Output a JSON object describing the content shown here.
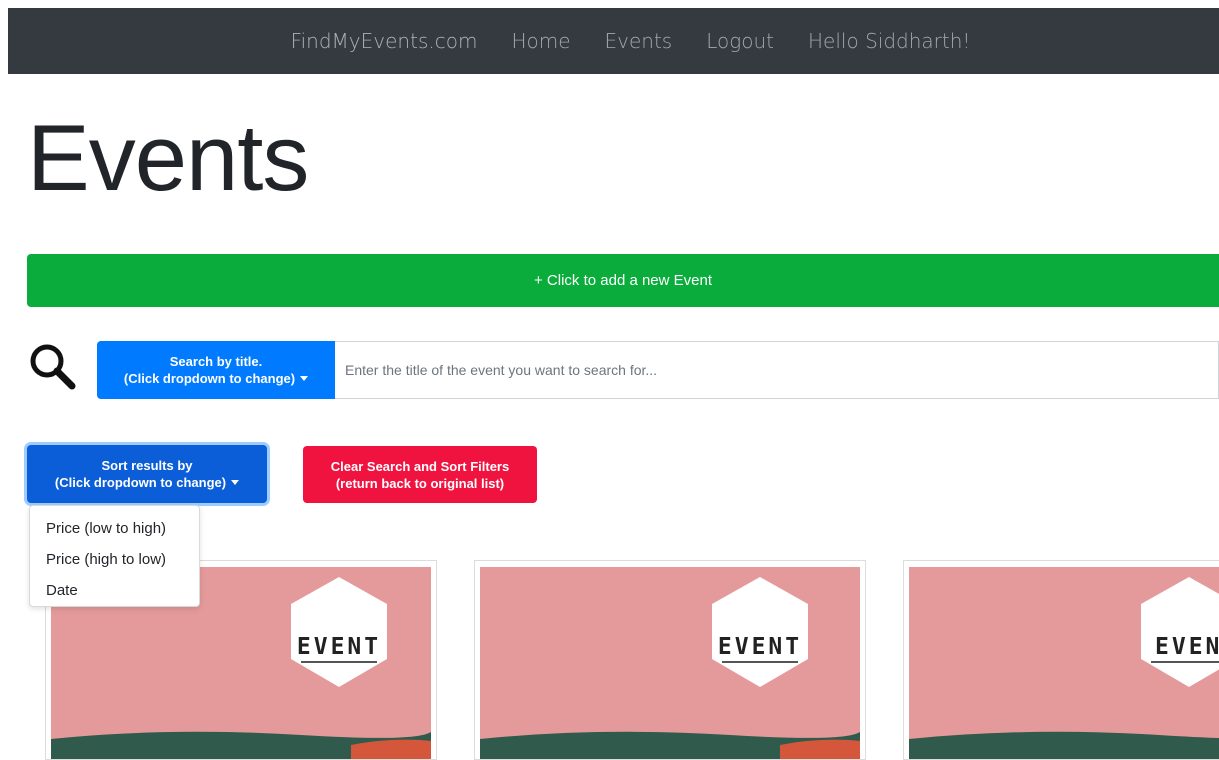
{
  "navbar": {
    "brand": "FindMyEvents.com",
    "links": [
      "Home",
      "Events",
      "Logout"
    ],
    "greeting": "Hello Siddharth!"
  },
  "page": {
    "title": "Events"
  },
  "add_button": {
    "label": "+ Click to add a new Event"
  },
  "search": {
    "type_line1": "Search by title.",
    "type_line2": "(Click dropdown to change)",
    "placeholder": "Enter the title of the event you want to search for..."
  },
  "sort": {
    "line1": "Sort results by",
    "line2": "(Click dropdown to change)",
    "options": [
      "Price (low to high)",
      "Price (high to low)",
      "Date"
    ]
  },
  "clear": {
    "line1": "Clear Search and Sort Filters",
    "line2": "(return back to original list)"
  },
  "cards": [
    {
      "badge": "EVENT"
    },
    {
      "badge": "EVENT"
    },
    {
      "badge": "EVEN"
    }
  ],
  "colors": {
    "navbar": "#343a40",
    "add_button": "#0aad3c",
    "primary": "#007bff",
    "danger": "#f0123f",
    "card_image": "#e49a9a"
  }
}
